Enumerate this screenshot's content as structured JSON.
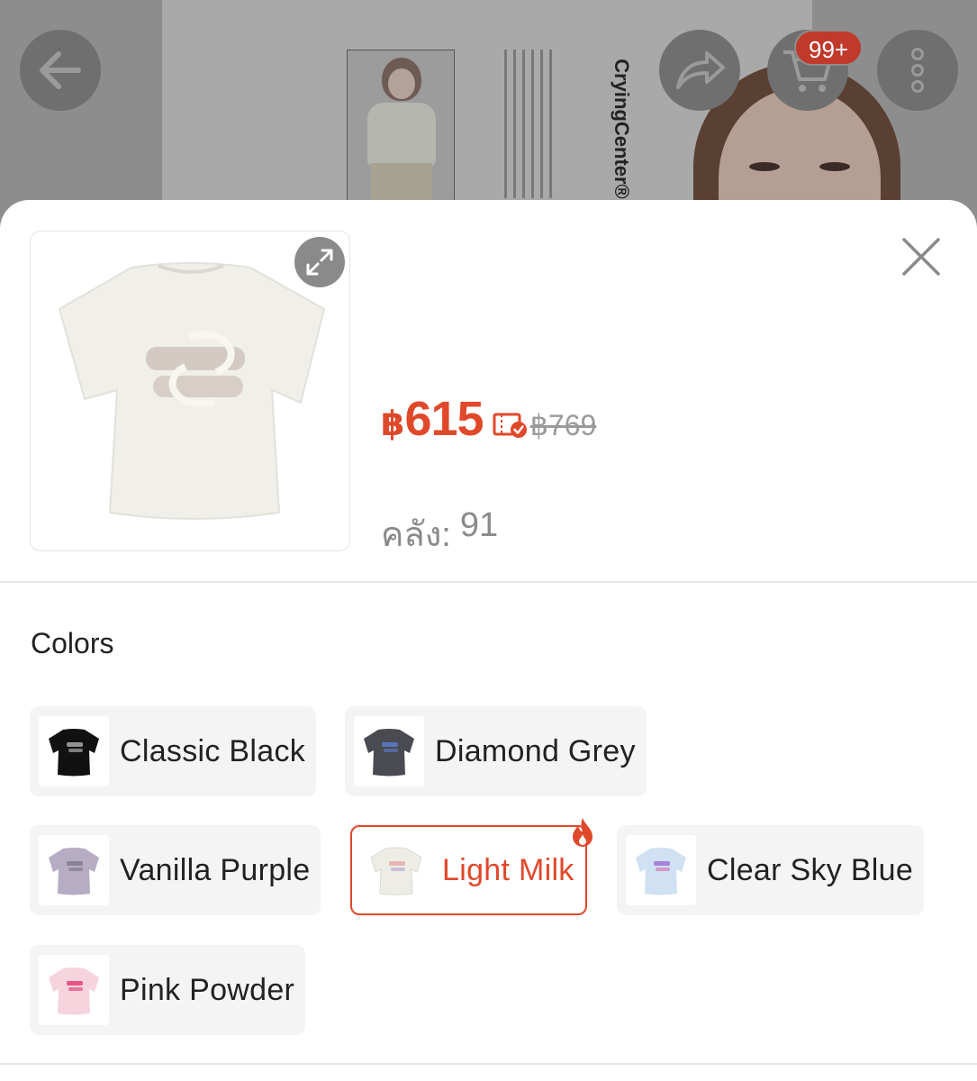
{
  "header": {
    "cart_badge": "99+",
    "brand_text": "CryingCenter®",
    "icons": [
      "back-arrow-icon",
      "share-icon",
      "cart-icon",
      "more-vertical-icon"
    ]
  },
  "sheet": {
    "price_symbol": "฿",
    "price": "615",
    "old_price": "฿769",
    "stock_label": "คลัง:",
    "stock_value": "91",
    "colors_title": "Colors",
    "colors": [
      {
        "label": "Classic Black",
        "swatch": "#111111",
        "selected": false,
        "hot": false
      },
      {
        "label": "Diamond Grey",
        "swatch": "#4a4b50",
        "selected": false,
        "hot": false
      },
      {
        "label": "Vanilla Purple",
        "swatch": "#b6acc4",
        "selected": false,
        "hot": false
      },
      {
        "label": "Light Milk",
        "swatch": "#eeede5",
        "selected": true,
        "hot": true
      },
      {
        "label": "Clear Sky Blue",
        "swatch": "#cfe1f2",
        "selected": false,
        "hot": false
      },
      {
        "label": "Pink Powder",
        "swatch": "#f6d4dd",
        "selected": false,
        "hot": false
      }
    ]
  },
  "theme": {
    "accent": "#e0482a",
    "muted": "#9a9a9a"
  }
}
